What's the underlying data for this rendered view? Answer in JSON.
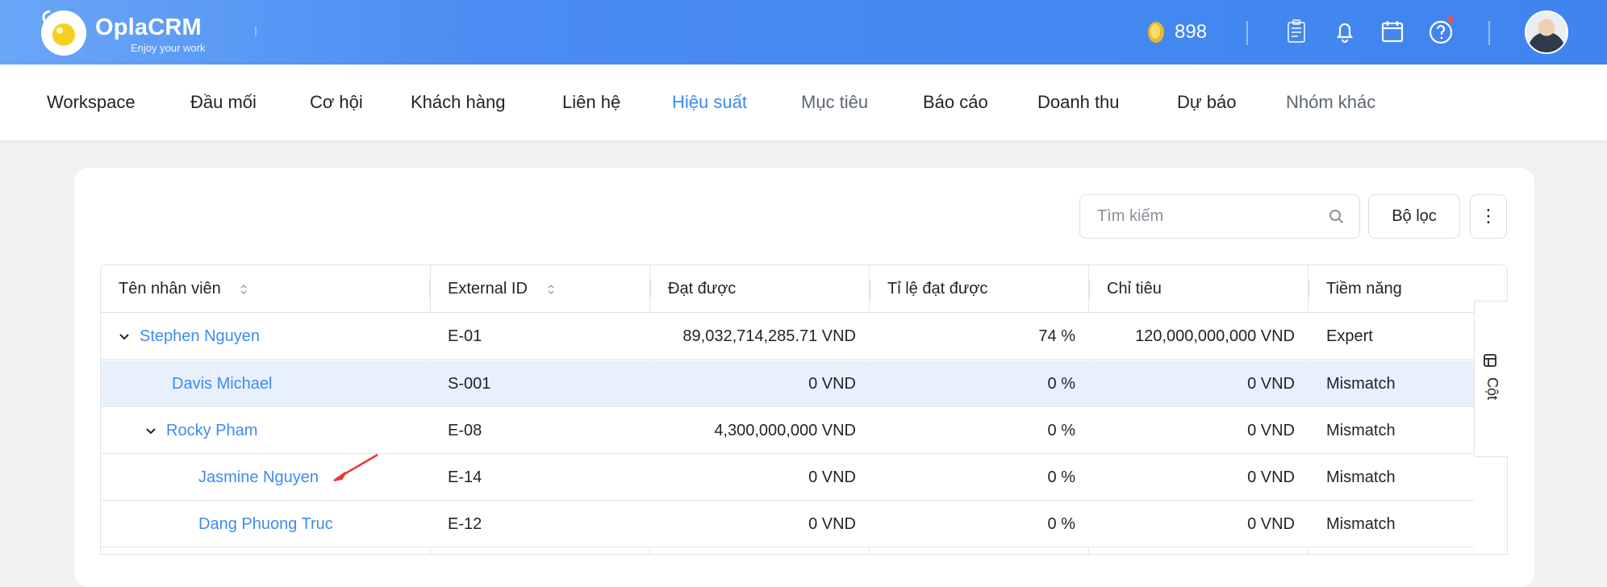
{
  "header": {
    "brand": "OplaCRM",
    "tagline": "Enjoy your work",
    "coins": "898",
    "accent": "#3e8bf0"
  },
  "nav": {
    "items": [
      "Workspace",
      "Đầu mối",
      "Cơ hội",
      "Khách hàng",
      "Liên hệ",
      "Hiệu suất",
      "Mục tiêu",
      "Báo cáo",
      "Doanh thu",
      "Dự báo",
      "Nhóm khác"
    ],
    "active": "Hiệu suất"
  },
  "toolbar": {
    "search_placeholder": "Tìm kiếm",
    "filter_label": "Bộ lọc",
    "more_label": "⋮"
  },
  "table": {
    "columns": [
      "Tên nhân viên",
      "External ID",
      "Đạt được",
      "Tỉ lệ đạt được",
      "Chỉ tiêu",
      "Tiềm năng"
    ],
    "rows": [
      {
        "name": "Stephen Nguyen",
        "id": "E-01",
        "achieved": "89,032,714,285.71 VND",
        "rate": "74 %",
        "target": "120,000,000,000 VND",
        "potential": "Expert"
      },
      {
        "name": "Davis Michael",
        "id": "S-001",
        "achieved": "0 VND",
        "rate": "0 %",
        "target": "0 VND",
        "potential": "Mismatch"
      },
      {
        "name": "Rocky Pham",
        "id": "E-08",
        "achieved": "4,300,000,000 VND",
        "rate": "0 %",
        "target": "0 VND",
        "potential": "Mismatch"
      },
      {
        "name": "Jasmine Nguyen",
        "id": "E-14",
        "achieved": "0 VND",
        "rate": "0 %",
        "target": "0 VND",
        "potential": "Mismatch"
      },
      {
        "name": "Dang Phuong Truc",
        "id": "E-12",
        "achieved": "0 VND",
        "rate": "0 %",
        "target": "0 VND",
        "potential": "Mismatch"
      }
    ]
  },
  "side_panel": {
    "label": "Cột"
  }
}
